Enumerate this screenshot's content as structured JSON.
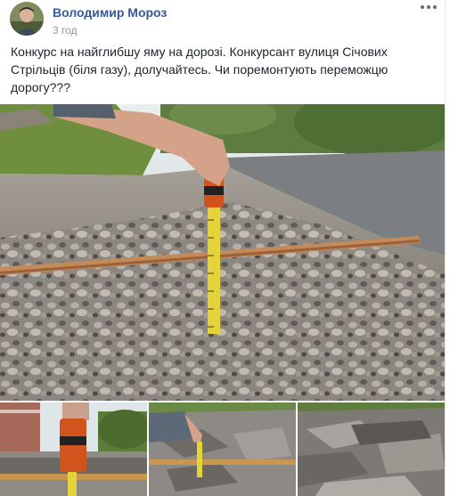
{
  "post": {
    "author": "Володимир Мороз",
    "timestamp": "3 год",
    "text": "Конкурс на найглибшу яму на дорозі. Конкурсант вулиця Січових Стрільців (біля газу), долучайтесь. Чи поремонтують переможцю дорогу???",
    "icons": {
      "avatar": "avatar-photo",
      "menu": "more-options-icon"
    },
    "colors": {
      "author_link": "#385898",
      "meta": "#90949c",
      "text": "#1d2129"
    }
  }
}
